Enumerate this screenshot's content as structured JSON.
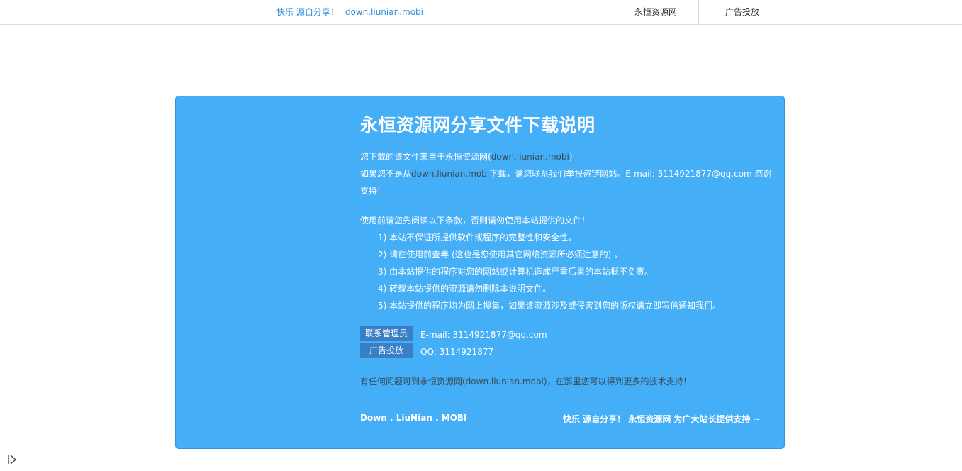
{
  "header": {
    "slogan": "快乐 源自分享！",
    "slogan_domain": "down.liunian.mobi",
    "nav": [
      "永恒资源网",
      "广告投放"
    ]
  },
  "panel": {
    "title": "永恒资源网分享文件下载说明",
    "intro_line1_prefix": "您下载的该文件来自于永恒资源网(",
    "intro_line1_domain": "down.liunian.mobi",
    "intro_line1_suffix": ")",
    "intro_line2_prefix": "如果您不是从",
    "intro_line2_domain": "down.liunian.mobi",
    "intro_line2_suffix": "下载，请您联系我们举报盗链网站。E-mail: 3114921877@qq.com 感谢支持!",
    "notice": "使用前请您先阅读以下条款，否则请勿使用本站提供的文件！",
    "terms": [
      "1) 本站不保证所提供软件或程序的完整性和安全性。",
      "2) 请在使用前查毒 (这也是您使用其它网络资源所必须注意的) 。",
      "3) 由本站提供的程序对您的网站或计算机造成严重后果的本站概不负责。",
      "4) 转载本站提供的资源请勿删除本说明文件。",
      "5) 本站提供的程序均为网上搜集，如果该资源涉及或侵害到您的版权请立即写信通知我们。"
    ],
    "contact_label": "联系管理员",
    "contact_value": "E-mail: 3114921877@qq.com",
    "ad_label": "广告投放",
    "ad_value": "QQ: 3114921877",
    "support": "有任何问题可到永恒资源网(down.liunian.mobi)，在那里您可以得到更多的技术支持！",
    "footer_left": "Down . LiuNian . MOBI",
    "footer_right": "快乐 源自分享！  永恒资源网 为广大站长提供支持 ~"
  },
  "colors": {
    "panel_bg": "#44aef7",
    "tag_bg": "#3a7fc6",
    "link_blue": "#2e8fd6"
  }
}
